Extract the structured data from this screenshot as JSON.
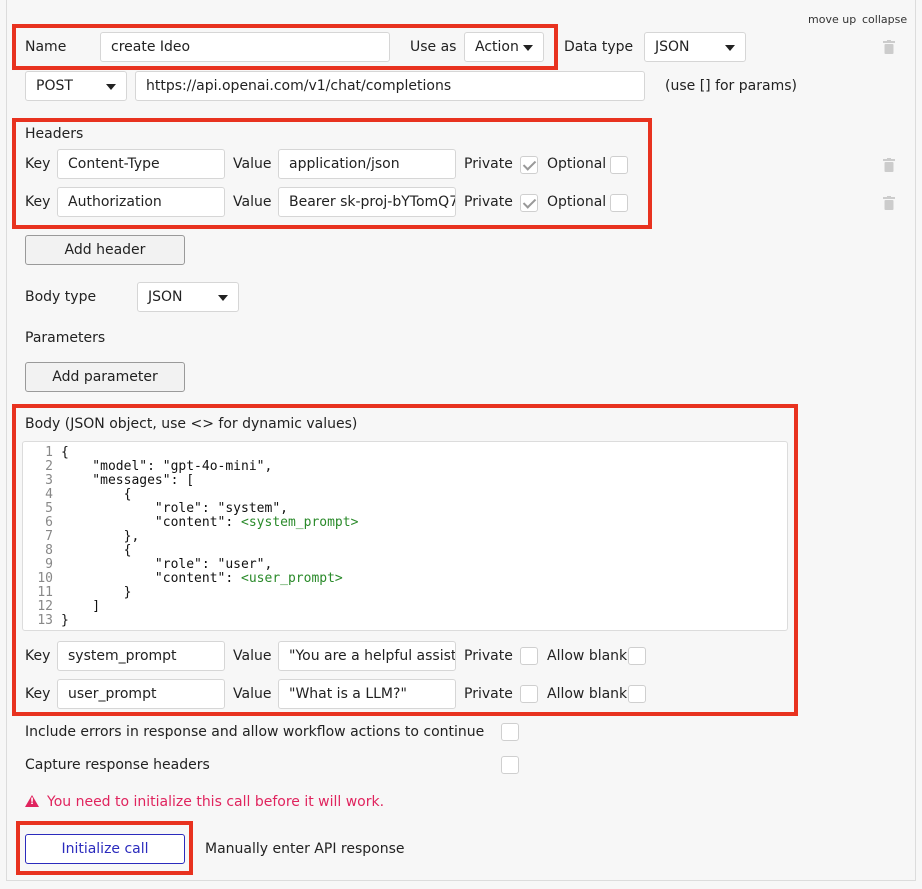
{
  "top_links": {
    "move_up": "move up",
    "collapse": "collapse"
  },
  "call": {
    "name_label": "Name",
    "name_value": "create Ideo",
    "use_as_label": "Use as",
    "use_as_value": "Action",
    "data_type_label": "Data type",
    "data_type_value": "JSON",
    "method_value": "POST",
    "url_value": "https://api.openai.com/v1/chat/completions",
    "url_hint": "(use [] for params)"
  },
  "headers": {
    "title": "Headers",
    "key_label": "Key",
    "value_label": "Value",
    "private_label": "Private",
    "optional_label": "Optional",
    "rows": [
      {
        "key": "Content-Type",
        "value": "application/json",
        "private": true,
        "optional": false
      },
      {
        "key": "Authorization",
        "value": "Bearer sk-proj-bYTomQ7(",
        "private": true,
        "optional": false
      }
    ],
    "add_button": "Add header"
  },
  "body_type": {
    "label": "Body type",
    "value": "JSON"
  },
  "parameters": {
    "label": "Parameters",
    "add_button": "Add parameter"
  },
  "body": {
    "title": "Body (JSON object, use <> for dynamic values)",
    "line_numbers": [
      "1",
      "2",
      "3",
      "4",
      "5",
      "6",
      "7",
      "8",
      "9",
      "10",
      "11",
      "12",
      "13"
    ],
    "lines": [
      "{",
      "    \"model\": \"gpt-4o-mini\",",
      "    \"messages\": [",
      "        {",
      "            \"role\": \"system\",",
      "            \"content\": ",
      "        },",
      "        {",
      "            \"role\": \"user\",",
      "            \"content\": ",
      "        }",
      "    ]",
      "}"
    ],
    "dynamic_system": "<system_prompt>",
    "dynamic_user": "<user_prompt>",
    "params": [
      {
        "key": "system_prompt",
        "value": "\"You are a helpful assista",
        "private": false,
        "allow_blank": false
      },
      {
        "key": "user_prompt",
        "value": "\"What is a LLM?\"",
        "private": false,
        "allow_blank": false
      }
    ],
    "allow_blank_label": "Allow blank"
  },
  "options": {
    "include_errors": "Include errors in response and allow workflow actions to continue",
    "capture_headers": "Capture response headers"
  },
  "warning": "You need to initialize this call before it will work.",
  "footer": {
    "initialize_button": "Initialize call",
    "manual_link": "Manually enter API response"
  }
}
